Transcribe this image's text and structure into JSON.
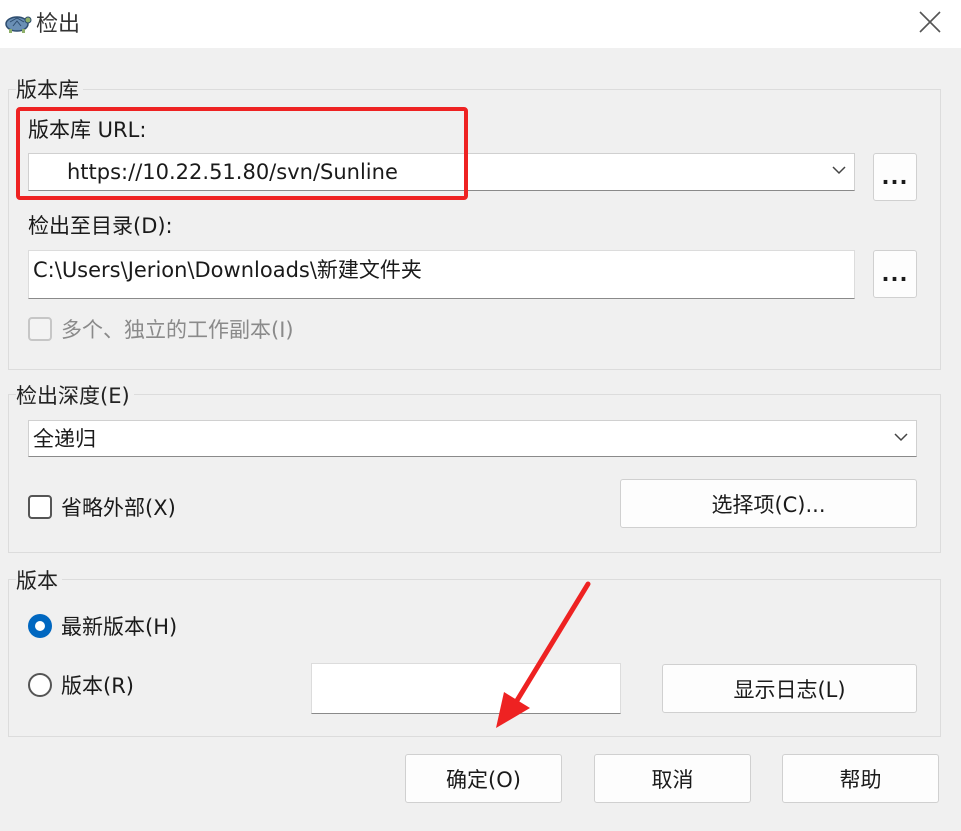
{
  "window": {
    "title": "检出",
    "icon": "tortoise-icon",
    "close_icon": "close-icon"
  },
  "repository": {
    "group_title": "版本库",
    "url_label": "版本库 URL:",
    "url_value": "https://10.22.51.80/svn/Sunline",
    "browse_label": "...",
    "checkout_dir_label": "检出至目录(D):",
    "checkout_dir_value": "C:\\Users\\Jerion\\Downloads\\新建文件夹",
    "browse_dir_label": "...",
    "multi_wc_label": "多个、独立的工作副本(I)"
  },
  "depth": {
    "group_title": "检出深度(E)",
    "selected": "全递归",
    "omit_externals_label": "省略外部(X)",
    "options_button": "选择项(C)..."
  },
  "revision": {
    "group_title": "版本",
    "head_label": "最新版本(H)",
    "revision_label": "版本(R)",
    "revision_value": "",
    "show_log_button": "显示日志(L)",
    "selected": "head"
  },
  "footer": {
    "ok_label": "确定(O)",
    "cancel_label": "取消",
    "help_label": "帮助"
  },
  "colors": {
    "accent": "#0067c0",
    "annotation": "#ee2222"
  }
}
